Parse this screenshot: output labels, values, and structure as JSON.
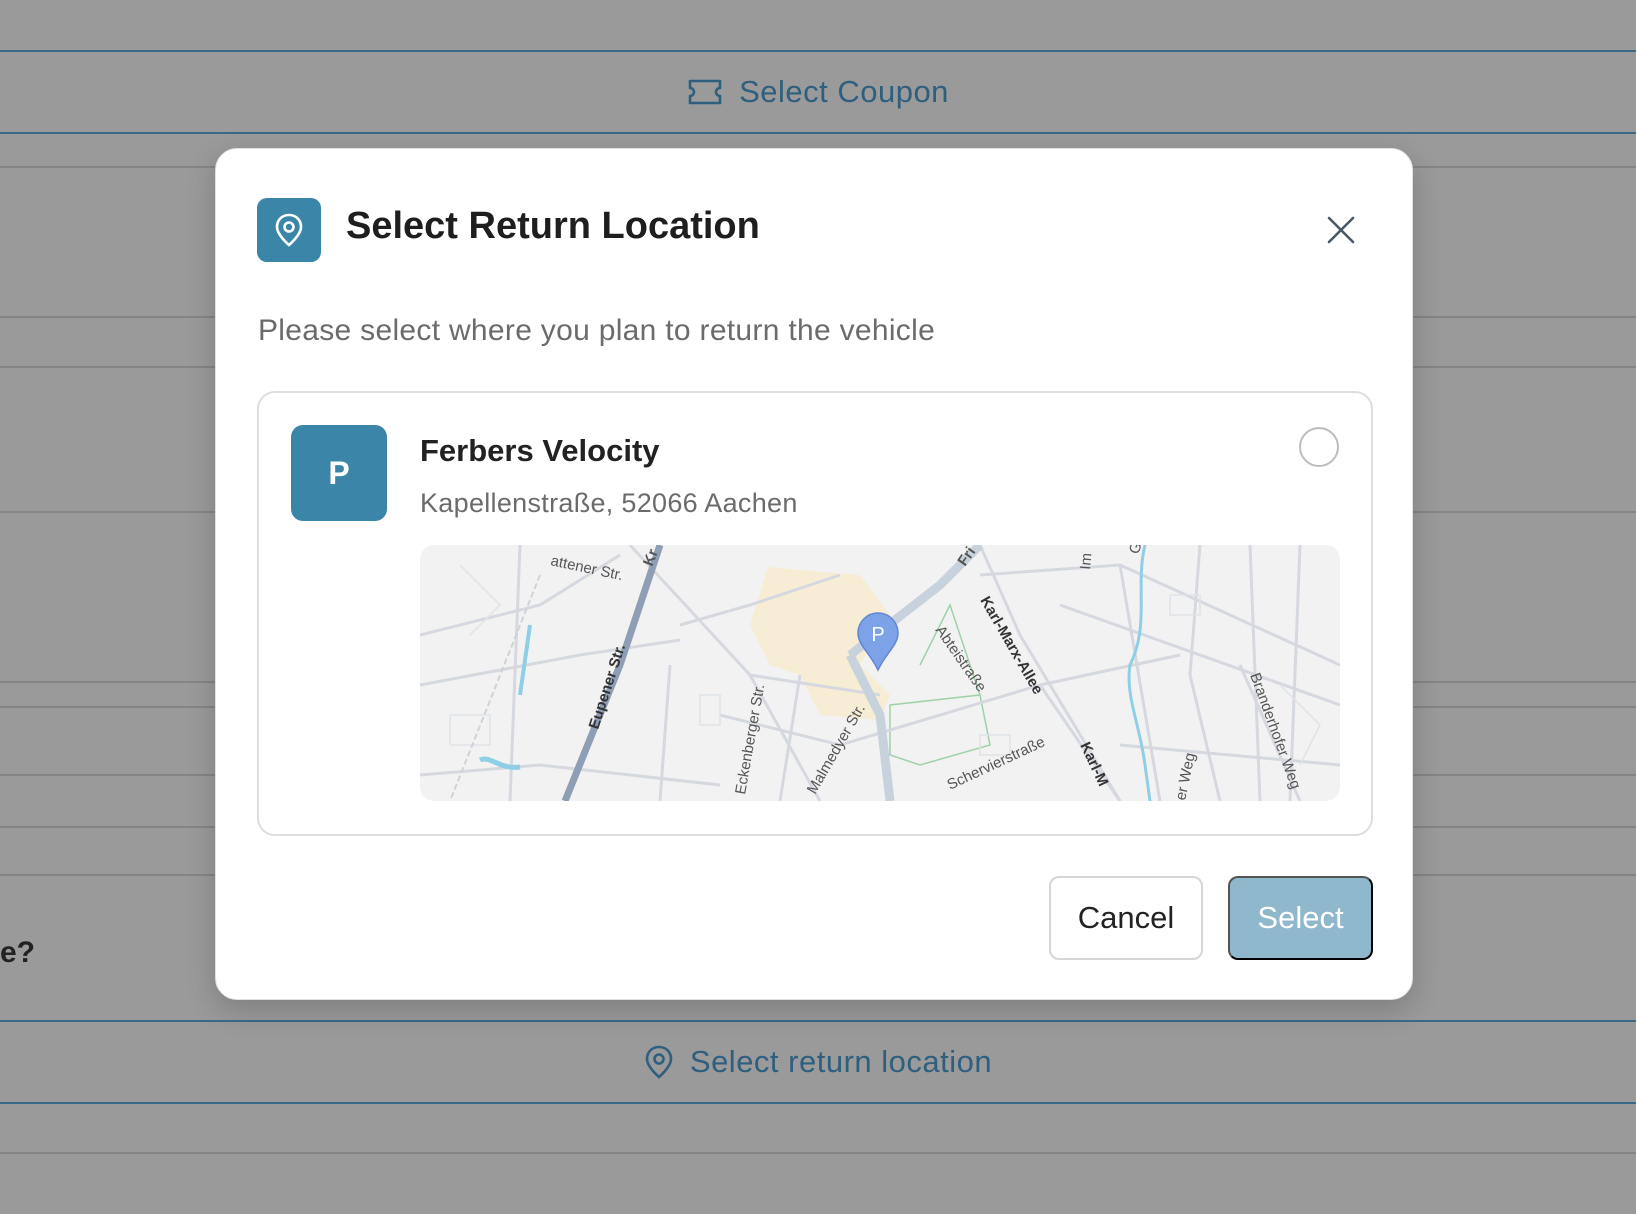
{
  "background": {
    "coupon_button_label": "Select Coupon",
    "question_fragment": "e?",
    "return_location_button_label": "Select return location"
  },
  "modal": {
    "title": "Select Return Location",
    "subtitle": "Please select where you plan to return the vehicle",
    "location": {
      "badge": "P",
      "name": "Ferbers Velocity",
      "address": "Kapellenstraße, 52066 Aachen",
      "selected": false,
      "map_marker_label": "P",
      "street_labels": {
        "s1": "attener Str.",
        "s2": "Kr",
        "s3": "Eupener Str.",
        "s4": "Eckenberger Str.",
        "s5": "Malmedyer Str.",
        "s6": "Abteistraße",
        "s7": "Karl-Marx-Allee",
        "s8": "Karl-M",
        "s9": "Schervierstraße",
        "s10": "Fri",
        "s11": "Im",
        "s12": "Branderhofer Weg",
        "s13": "er Weg",
        "s14": "G"
      }
    },
    "cancel_label": "Cancel",
    "select_label": "Select"
  },
  "colors": {
    "accent": "#3a85a8",
    "accent_disabled": "#8fb8cd",
    "overlay": "#9a9a9a",
    "background_link": "#2f5f7e"
  }
}
